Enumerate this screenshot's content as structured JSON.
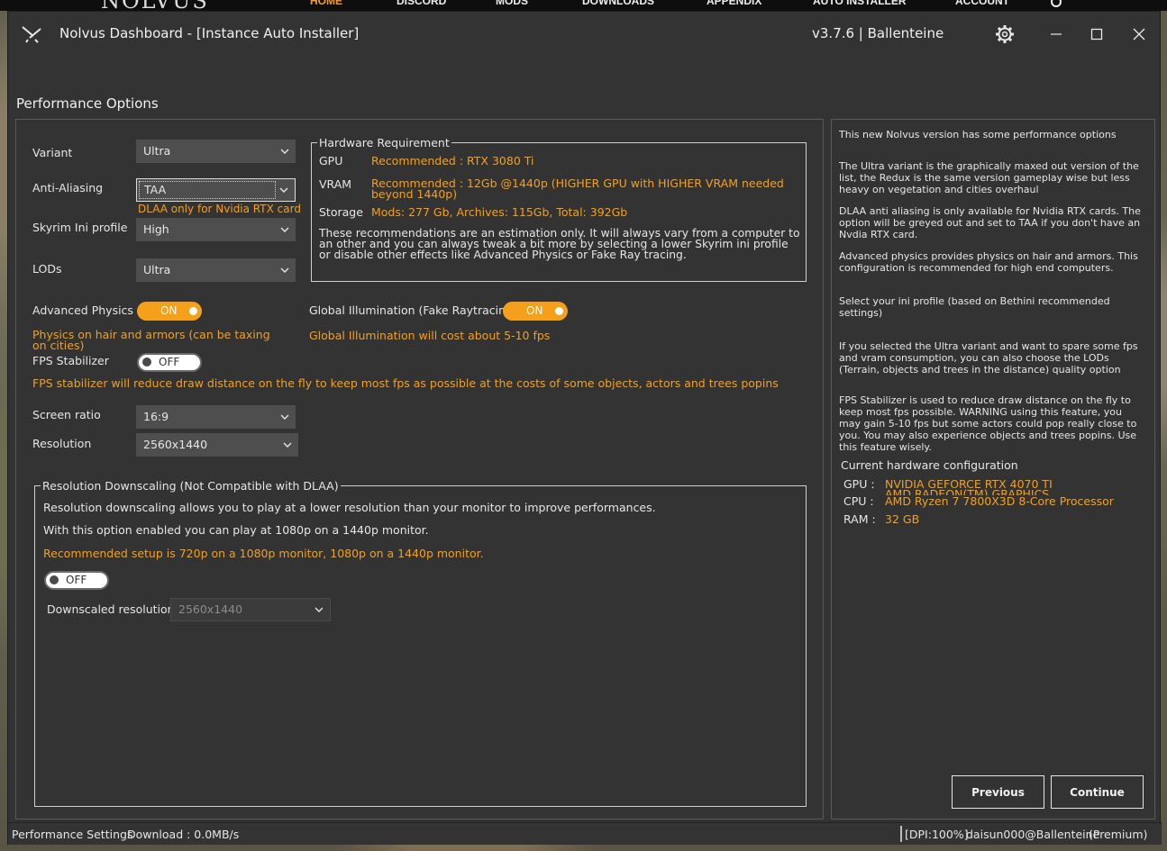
{
  "website": {
    "logo": "NOLVUS",
    "nav": [
      "HOME",
      "DISCORD",
      "MODS",
      "DOWNLOADS",
      "APPENDIX",
      "AUTO INSTALLER",
      "ACCOUNT"
    ]
  },
  "window": {
    "title": "Nolvus Dashboard - [Instance Auto Installer]",
    "version": "v3.7.6 | Ballenteine"
  },
  "page_title": "Performance Options",
  "form": {
    "variant": {
      "label": "Variant",
      "value": "Ultra"
    },
    "anti_aliasing": {
      "label": "Anti-Aliasing",
      "value": "TAA",
      "note": "DLAA only for Nvidia RTX card"
    },
    "ini_profile": {
      "label": "Skyrim Ini profile",
      "value": "High"
    },
    "lods": {
      "label": "LODs",
      "value": "Ultra"
    },
    "advanced_physics": {
      "label": "Advanced Physics",
      "state": "ON",
      "note": "Physics on hair and armors (can be taxing on cities)"
    },
    "global_illumination": {
      "label": "Global Illumination (Fake Raytracing)",
      "state": "ON",
      "note": "Global Illumination will cost about 5-10 fps"
    },
    "fps_stabilizer": {
      "label": "FPS Stabilizer",
      "state": "OFF",
      "note": "FPS stabilizer will reduce draw distance on the fly to keep most fps as possible at the costs of some objects, actors and trees popins"
    },
    "screen_ratio": {
      "label": "Screen ratio",
      "value": "16:9"
    },
    "resolution": {
      "label": "Resolution",
      "value": "2560x1440"
    }
  },
  "hardware_requirement": {
    "title": "Hardware Requirement",
    "gpu_label": "GPU",
    "gpu_value": "Recommended : RTX 3080 Ti",
    "vram_label": "VRAM",
    "vram_value": "Recommended : 12Gb @1440p (HIGHER GPU with HIGHER VRAM needed beyond 1440p)",
    "storage_label": "Storage",
    "storage_value": "Mods: 277 Gb, Archives: 115Gb, Total: 392Gb",
    "disclaimer": "These recommendations are an estimation only. It will always vary from a computer to an other and you can always tweak a bit more by selecting a lower Skyrim ini profile or disable other effects like Advanced Physics or Fake Ray tracing."
  },
  "downscaling": {
    "title": "Resolution Downscaling (Not Compatible with DLAA)",
    "line1": "Resolution downscaling allows you to play at a lower resolution than your monitor to improve performances.",
    "line2": "With this option enabled you can play at 1080p on a 1440p monitor.",
    "recommended": "Recommended setup is 720p on a 1080p monitor, 1080p on a 1440p monitor.",
    "state": "OFF",
    "downscaled_label": "Downscaled resolution",
    "downscaled_value": "2560x1440"
  },
  "info": {
    "p1": "This new Nolvus version has some performance options",
    "p2": "The Ultra variant is the graphically maxed out version of the list, the Redux is the same version gameplay wise but less heavy on vegetation and cities overhaul",
    "p3": "DLAA anti aliasing is only available for Nvidia RTX cards. The option will be greyed out and set to TAA if you don't have an Nvdia RTX card.",
    "p4": "Advanced physics provides physics on hair and armors. This configuration is recommended for high end computers.",
    "p5": "Select your ini profile (based on Bethini recommended settings)",
    "p6": "If you selected the Ultra variant and want to spare some fps and vram consumption, you can also choose the LODs (Terrain, objects and trees in the distance) quality option",
    "p7": "FPS Stabilizer is used to reduce draw distance on the fly to keep most fps possible. WARNING using this feature, you may gain 5-10 fps but some actors could pop really close to you. You may also experience objects and trees popins. Use this feature wisely.",
    "hw_title": "Current hardware configuration",
    "gpu_label": "GPU :",
    "gpu_value1": "NVIDIA GEFORCE RTX 4070 TI",
    "gpu_value2": "AMD RADEON(TM) GRAPHICS",
    "cpu_label": "CPU :",
    "cpu_value": "AMD Ryzen 7 7800X3D 8-Core Processor",
    "ram_label": "RAM :",
    "ram_value": "32 GB"
  },
  "buttons": {
    "previous": "Previous",
    "continue": "Continue"
  },
  "status": {
    "left": "Performance Settings",
    "download": "Download : 0.0MB/s",
    "dpi": "[DPI:100%]",
    "user": "daisun000@Ballenteine",
    "plan": "(Premium)"
  },
  "colors": {
    "accent": "#f5a01a",
    "window_bg": "#333333",
    "field_bg": "#4e4e4e"
  },
  "icons": {
    "app": "nolvus-swords-icon",
    "settings": "gear-icon",
    "minimize": "minimize-icon",
    "maximize": "maximize-icon",
    "close": "close-icon",
    "dropdown": "chevron-down-icon",
    "search": "search-icon"
  }
}
